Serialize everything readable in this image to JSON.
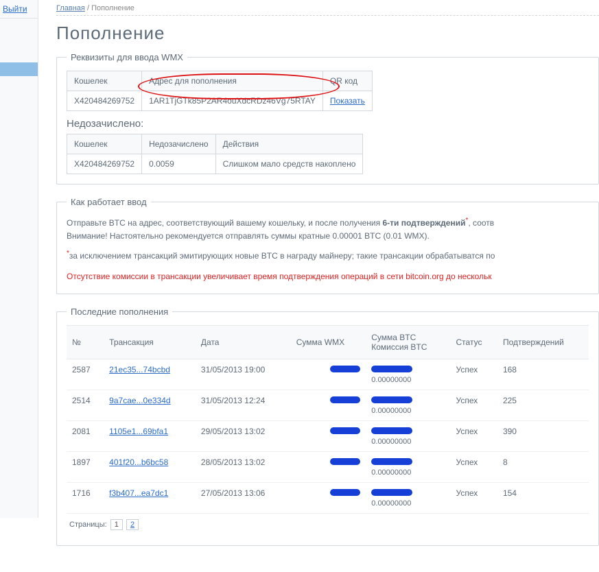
{
  "sidebar": {
    "exit": "Выйти"
  },
  "breadcrumb": {
    "home": "Главная",
    "sep": "/",
    "current": "Пополнение"
  },
  "title": "Пополнение",
  "deposit": {
    "legend": "Реквизиты для ввода WMX",
    "cols": {
      "wallet": "Кошелек",
      "address": "Адрес для пополнения",
      "qr": "QR код"
    },
    "wallet": "X420484269752",
    "address": "1AR1TjGTk85P2AR4ouXdcRDz46Vg75RTAY",
    "show": "Показать"
  },
  "pending": {
    "title": "Недозачислено:",
    "cols": {
      "wallet": "Кошелек",
      "pending": "Недозачислено",
      "actions": "Действия"
    },
    "wallet": "X420484269752",
    "amount": "0.0059",
    "action": "Слишком мало средств накоплено"
  },
  "how": {
    "legend": "Как работает ввод",
    "p1a": "Отправьте BTC на адрес, соответствующий вашему кошельку, и после получения ",
    "p1b": "6-ти подтверждений",
    "p1c": ", соотв",
    "p2": "Внимание! Настоятельно рекомендуется отправлять суммы кратные 0.00001 BTC (0.01 WMX).",
    "note": "за исключением транcакций эмитирующих новые BTC в награду майнеру; такие транcакции обрабатыватся по",
    "warn": "Отсутствие комиссии в транcакции увеличивает время подтверждения операций в сети bitcoin.org до нескольк"
  },
  "txs": {
    "legend": "Последние пополнения",
    "cols": {
      "n": "№",
      "tx": "Транcакция",
      "date": "Дата",
      "wmx": "Сумма WMX",
      "btc1": "Сумма BTC",
      "btc2": "Комиссия BTC",
      "status": "Статус",
      "conf": "Подтверждений"
    },
    "rows": [
      {
        "n": "2587",
        "tx": "21ec35...74bcbd",
        "date": "31/05/2013 19:00",
        "fee": "0.00000000",
        "status": "Успех",
        "conf": "168"
      },
      {
        "n": "2514",
        "tx": "9a7cae...0e334d",
        "date": "31/05/2013 12:24",
        "fee": "0.00000000",
        "status": "Успех",
        "conf": "225"
      },
      {
        "n": "2081",
        "tx": "1105e1...69bfa1",
        "date": "29/05/2013 13:02",
        "fee": "0.00000000",
        "status": "Успех",
        "conf": "390"
      },
      {
        "n": "1897",
        "tx": "401f20...b6bc58",
        "date": "28/05/2013 13:02",
        "fee": "0.00000000",
        "status": "Успех",
        "conf": "8"
      },
      {
        "n": "1716",
        "tx": "f3b407...ea7dc1",
        "date": "27/05/2013 13:06",
        "fee": "0.00000000",
        "status": "Успех",
        "conf": "154"
      }
    ],
    "pages_label": "Страницы:",
    "pages": [
      "1",
      "2"
    ]
  }
}
